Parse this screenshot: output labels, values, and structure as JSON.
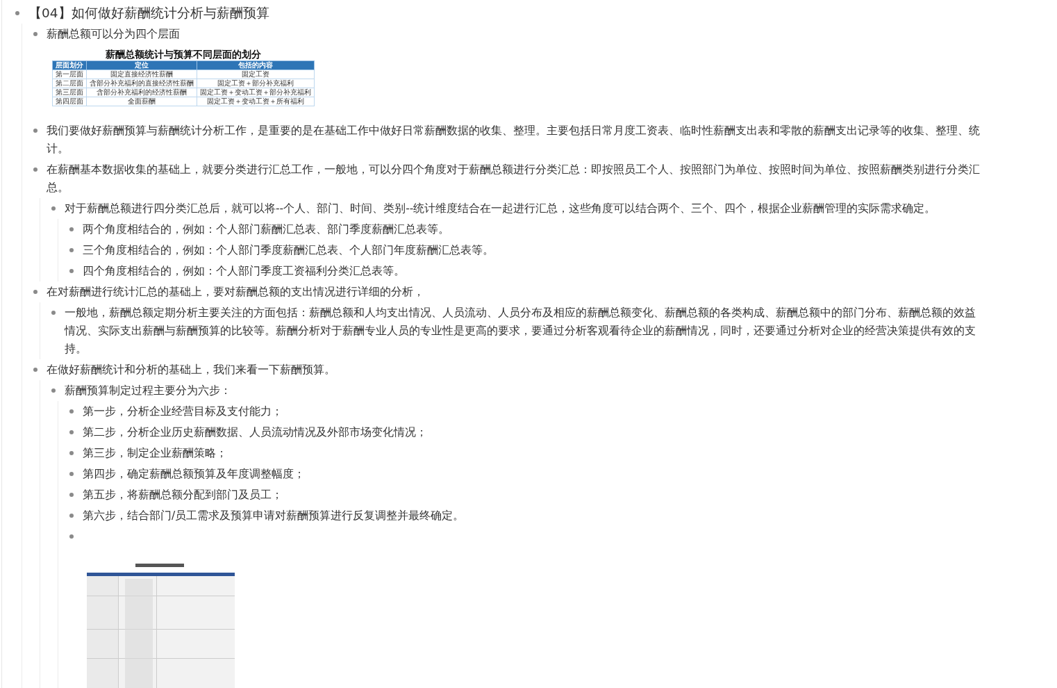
{
  "outline": [
    {
      "text": "【04】如何做好薪酬统计分析与薪酬预算",
      "children": [
        {
          "text": "薪酬总额可以分为四个层面",
          "table": {
            "title": "薪酬总额统计与预算不同层面的划分",
            "columns": [
              "层面划分",
              "定位",
              "包括的内容"
            ],
            "rows": [
              [
                "第一层面",
                "固定直接经济性薪酬",
                "固定工资"
              ],
              [
                "第二层面",
                "含部分补充福利的直接经济性薪酬",
                "固定工资＋部分补充福利"
              ],
              [
                "第三层面",
                "含部分补充福利的经济性薪酬",
                "固定工资＋变动工资＋部分补充福利"
              ],
              [
                "第四层面",
                "全面薪酬",
                "固定工资＋变动工资＋所有福利"
              ]
            ]
          }
        },
        {
          "text": "我们要做好薪酬预算与薪酬统计分析工作，是重要的是在基础工作中做好日常薪酬数据的收集、整理。主要包括日常月度工资表、临时性薪酬支出表和零散的薪酬支出记录等的收集、整理、统计。"
        },
        {
          "text": "在薪酬基本数据收集的基础上，就要分类进行汇总工作，一般地，可以分四个角度对于薪酬总额进行分类汇总：即按照员工个人、按照部门为单位、按照时间为单位、按照薪酬类别进行分类汇总。",
          "children": [
            {
              "text": "对于薪酬总额进行四分类汇总后，就可以将--个人、部门、时间、类别--统计维度结合在一起进行汇总，这些角度可以结合两个、三个、四个，根据企业薪酬管理的实际需求确定。",
              "children": [
                {
                  "text": "两个角度相结合的，例如：个人部门薪酬汇总表、部门季度薪酬汇总表等。"
                },
                {
                  "text": "三个角度相结合的，例如：个人部门季度薪酬汇总表、个人部门年度薪酬汇总表等。"
                },
                {
                  "text": "四个角度相结合的，例如：个人部门季度工资福利分类汇总表等。"
                }
              ]
            }
          ]
        },
        {
          "text": "在对薪酬进行统计汇总的基础上，要对薪酬总额的支出情况进行详细的分析，",
          "children": [
            {
              "text": "一般地，薪酬总额定期分析主要关注的方面包括：薪酬总额和人均支出情况、人员流动、人员分布及相应的薪酬总额变化、薪酬总额的各类构成、薪酬总额中的部门分布、薪酬总额的效益情况、实际支出薪酬与薪酬预算的比较等。薪酬分析对于薪酬专业人员的专业性是更高的要求，要通过分析客观看待企业的薪酬情况，同时，还要通过分析对企业的经营决策提供有效的支持。"
            }
          ]
        },
        {
          "text": "在做好薪酬统计和分析的基础上，我们来看一下薪酬预算。",
          "children": [
            {
              "text": "薪酬预算制定过程主要分为六步：",
              "children": [
                {
                  "text": "第一步，分析企业经营目标及支付能力；"
                },
                {
                  "text": "第二步，分析企业历史薪酬数据、人员流动情况及外部市场变化情况；"
                },
                {
                  "text": "第三步，制定企业薪酬策略；"
                },
                {
                  "text": "第四步，确定薪酬总额预算及年度调整幅度；"
                },
                {
                  "text": "第五步，将薪酬总额分配到部门及员工；"
                },
                {
                  "text": "第六步，结合部门/员工需求及预算申请对薪酬预算进行反复调整并最终确定。"
                },
                {
                  "picture": {
                    "kind": "picture"
                  }
                }
              ]
            }
          ]
        }
      ]
    }
  ]
}
